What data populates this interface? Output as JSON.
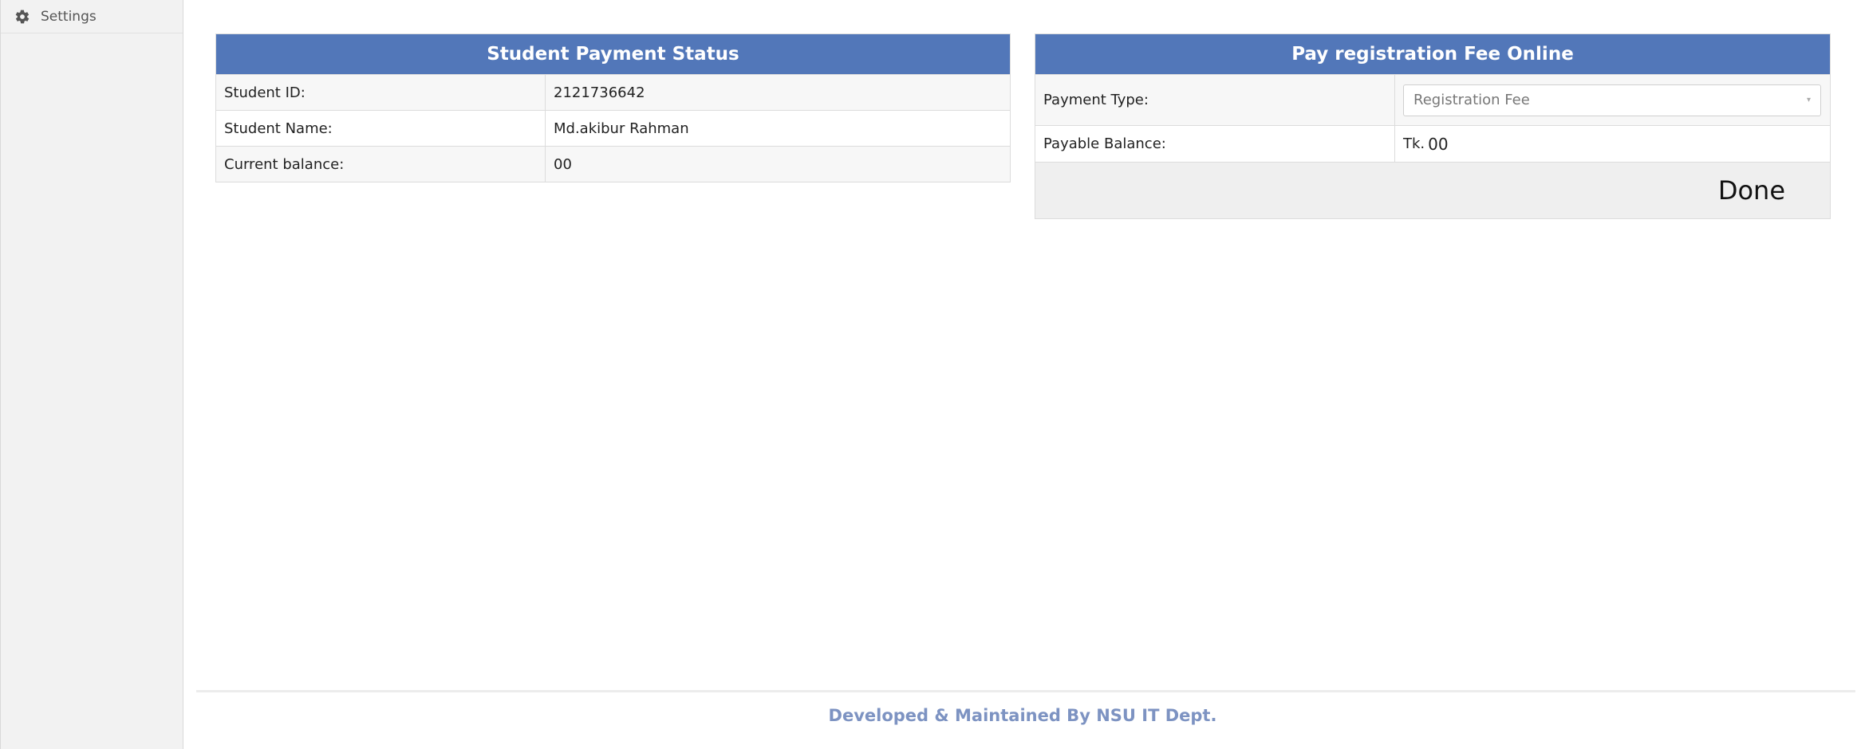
{
  "sidebar": {
    "items": [
      {
        "label": "Settings",
        "icon": "gear-icon"
      }
    ]
  },
  "payment_status": {
    "title": "Student Payment Status",
    "rows": [
      {
        "label": "Student ID:",
        "value": "2121736642"
      },
      {
        "label": "Student Name:",
        "value": "Md.akibur Rahman"
      },
      {
        "label": "Current balance:",
        "value": "00"
      }
    ]
  },
  "pay_online": {
    "title": "Pay registration Fee Online",
    "payment_type_label": "Payment Type:",
    "payment_type_selected": "Registration Fee",
    "payable_balance_label": "Payable Balance:",
    "payable_currency": "Tk.",
    "payable_amount": "00",
    "done_label": "Done"
  },
  "footer": {
    "text": "Developed & Maintained By NSU IT Dept."
  },
  "colors": {
    "header_bg": "#5277b9",
    "footer_text": "#7d93c2"
  }
}
